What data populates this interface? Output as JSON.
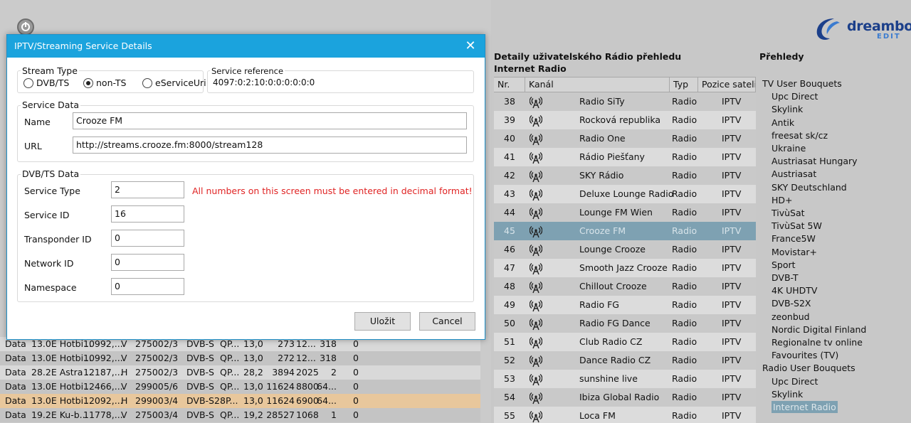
{
  "dialog": {
    "title": "IPTV/Streaming Service Details",
    "stream_type": {
      "label": "Stream Type",
      "options": [
        "DVB/TS",
        "non-TS",
        "eServiceUri"
      ],
      "selected": 1
    },
    "service_reference": {
      "label": "Service reference",
      "value": "4097:0:2:10:0:0:0:0:0:0"
    },
    "service_data": {
      "label": "Service Data",
      "name_label": "Name",
      "name_value": "Crooze FM",
      "url_label": "URL",
      "url_value": "http://streams.crooze.fm:8000/stream128"
    },
    "dvb_data": {
      "label": "DVB/TS Data",
      "warning": "All numbers on this screen must be entered in decimal format!",
      "fields": [
        {
          "label": "Service Type",
          "value": "2"
        },
        {
          "label": "Service ID",
          "value": "16"
        },
        {
          "label": "Transponder ID",
          "value": "0"
        },
        {
          "label": "Network ID",
          "value": "0"
        },
        {
          "label": "Namespace",
          "value": "0"
        }
      ]
    },
    "save_label": "Uložit",
    "cancel_label": "Cancel"
  },
  "logo": {
    "brand": "dreambox",
    "sub": "EDIT"
  },
  "center": {
    "title1": "Detaily uživatelského Rádio přehledu",
    "title2": "Internet Radio",
    "columns": [
      "Nr.",
      "Kanál",
      "Typ",
      "Pozice satelitu"
    ],
    "rows": [
      [
        "38",
        "Radio SiTy",
        "Radio",
        "IPTV"
      ],
      [
        "39",
        "Rocková republika",
        "Radio",
        "IPTV"
      ],
      [
        "40",
        "Radio One",
        "Radio",
        "IPTV"
      ],
      [
        "41",
        "Rádio Piešťany",
        "Radio",
        "IPTV"
      ],
      [
        "42",
        "SKY Rádio",
        "Radio",
        "IPTV"
      ],
      [
        "43",
        "Deluxe Lounge Radio",
        "Radio",
        "IPTV"
      ],
      [
        "44",
        "Lounge FM Wien",
        "Radio",
        "IPTV"
      ],
      [
        "45",
        "Crooze FM",
        "Radio",
        "IPTV"
      ],
      [
        "46",
        "Lounge Crooze",
        "Radio",
        "IPTV"
      ],
      [
        "47",
        "Smooth Jazz Crooze",
        "Radio",
        "IPTV"
      ],
      [
        "48",
        "Chillout Crooze",
        "Radio",
        "IPTV"
      ],
      [
        "49",
        "Radio FG",
        "Radio",
        "IPTV"
      ],
      [
        "50",
        "Radio FG Dance",
        "Radio",
        "IPTV"
      ],
      [
        "51",
        "Club Radio CZ",
        "Radio",
        "IPTV"
      ],
      [
        "52",
        "Dance Radio CZ",
        "Radio",
        "IPTV"
      ],
      [
        "53",
        "sunshine live",
        "Radio",
        "IPTV"
      ],
      [
        "54",
        "Ibiza Global Radio",
        "Radio",
        "IPTV"
      ],
      [
        "55",
        "Loca FM",
        "Radio",
        "IPTV"
      ]
    ],
    "selected_row": 7
  },
  "right": {
    "title": "Přehledy",
    "tv_root": "TV User Bouquets",
    "tv_items": [
      "Upc Direct",
      "Skylink",
      "Antik",
      "freesat sk/cz",
      "Ukraine",
      "Austriasat Hungary",
      "Austriasat",
      "SKY Deutschland",
      "HD+",
      "TivùSat",
      "TivùSat 5W",
      "France5W",
      "Movistar+",
      "Sport",
      "DVB-T",
      "4K UHDTV",
      "DVB-S2X",
      "zeonbud",
      "Nordic Digital Finland",
      "Regionalne tv online",
      "Favourites (TV)"
    ],
    "radio_root": "Radio User Bouquets",
    "radio_items": [
      "Upc Direct",
      "Skylink",
      "Internet Radio"
    ],
    "selected_radio": 2
  },
  "bottom_table": {
    "rows": [
      [
        "Data",
        "13.0E Hotbi...",
        "10992,...",
        "V",
        "27500",
        "2/3",
        "DVB-S",
        "QP...",
        "13,0",
        "273",
        "12...",
        "318",
        "0"
      ],
      [
        "Data",
        "13.0E Hotbi...",
        "10992,...",
        "V",
        "27500",
        "2/3",
        "DVB-S",
        "QP...",
        "13,0",
        "272",
        "12...",
        "318",
        "0"
      ],
      [
        "Data",
        "28.2E Astra ...",
        "12187,...",
        "H",
        "27500",
        "2/3",
        "DVB-S",
        "QP...",
        "28,2",
        "3894",
        "2025",
        "2",
        "0"
      ],
      [
        "Data",
        "13.0E Hotbi...",
        "12466,...",
        "V",
        "29900",
        "5/6",
        "DVB-S",
        "QP...",
        "13,0",
        "11624",
        "8800",
        "64...",
        "0"
      ],
      [
        "Data",
        "13.0E Hotbi...",
        "12092,...",
        "H",
        "29900",
        "3/4",
        "DVB-S2",
        "8P...",
        "13,0",
        "11624",
        "6900",
        "64...",
        "0"
      ],
      [
        "Data",
        "19.2E Ku-b...",
        "11778,...",
        "V",
        "27500",
        "3/4",
        "DVB-S",
        "QP...",
        "19,2",
        "28527",
        "1068",
        "1",
        "0"
      ]
    ]
  }
}
